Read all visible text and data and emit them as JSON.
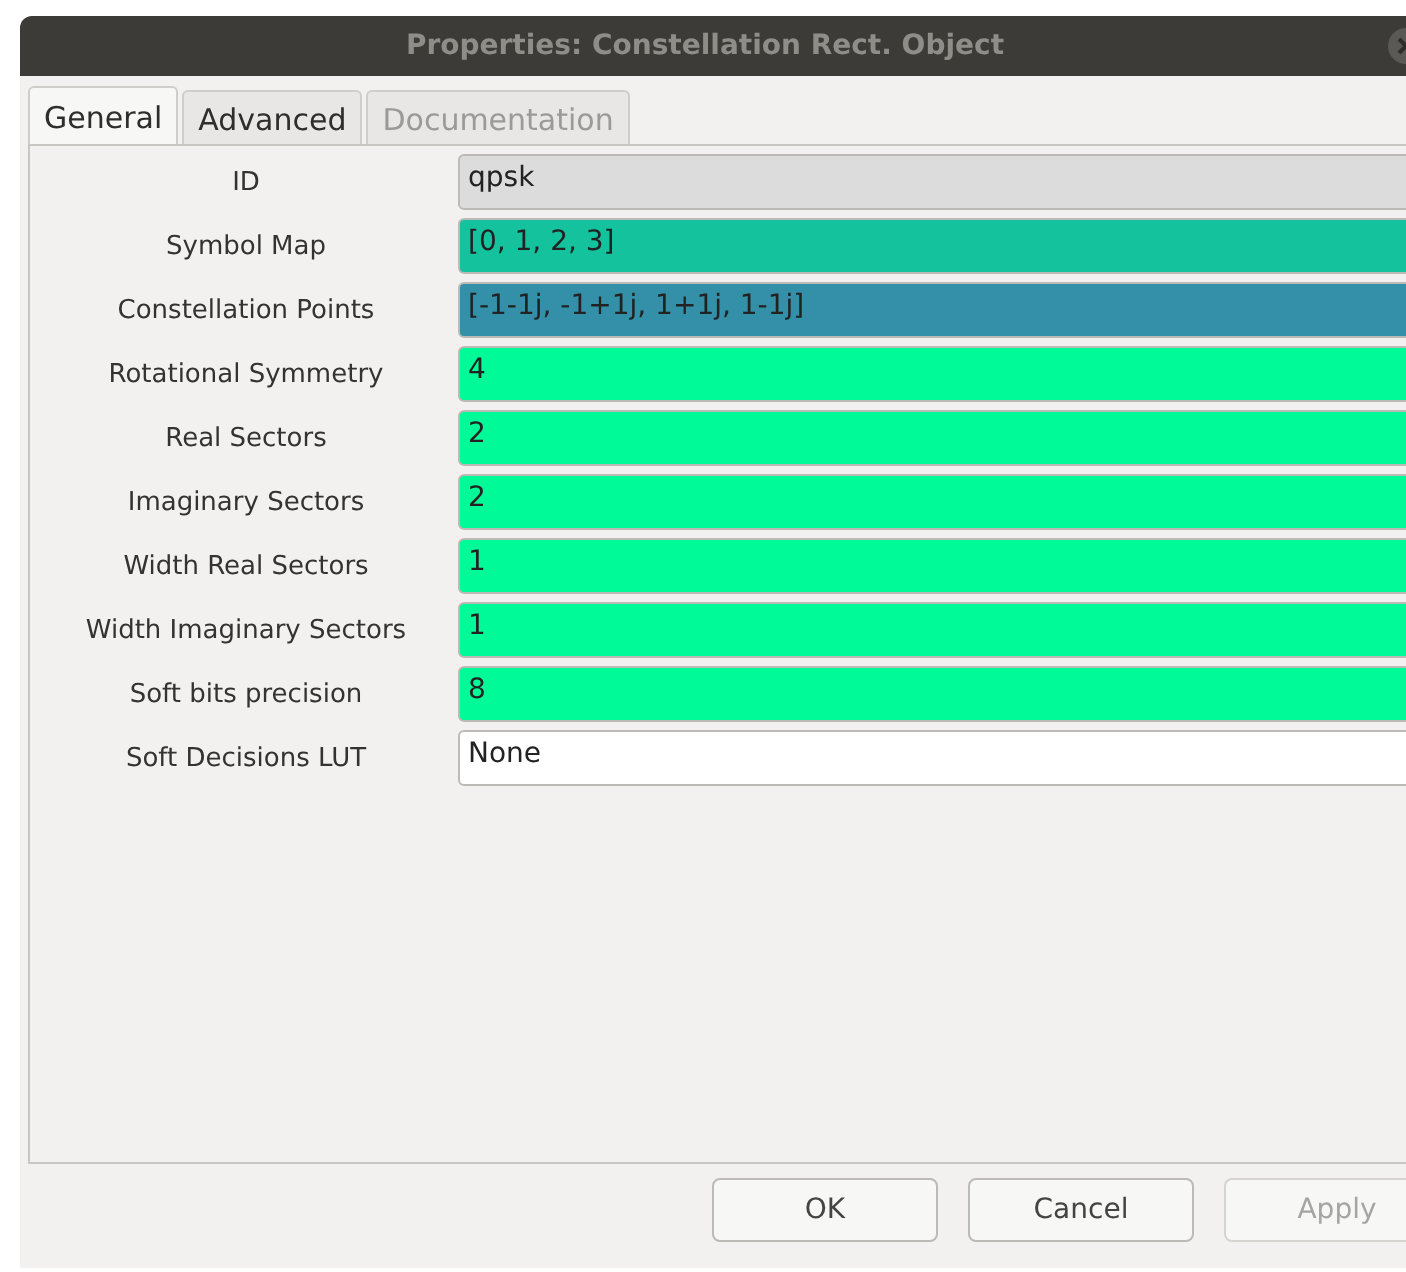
{
  "window": {
    "title": "Properties: Constellation Rect. Object"
  },
  "tabs": [
    {
      "label": "General",
      "selected": true,
      "disabled": false
    },
    {
      "label": "Advanced",
      "selected": false,
      "disabled": false
    },
    {
      "label": "Documentation",
      "selected": false,
      "disabled": true
    }
  ],
  "properties": [
    {
      "label": "ID",
      "value": "qpsk",
      "color": "#dcdcdc"
    },
    {
      "label": "Symbol Map",
      "value": "[0, 1, 2, 3]",
      "color": "#14c39e"
    },
    {
      "label": "Constellation Points",
      "value": "[-1-1j, -1+1j, 1+1j, 1-1j]",
      "color": "#3490a8"
    },
    {
      "label": "Rotational Symmetry",
      "value": "4",
      "color": "#00fa98"
    },
    {
      "label": "Real Sectors",
      "value": "2",
      "color": "#00fa98"
    },
    {
      "label": "Imaginary Sectors",
      "value": "2",
      "color": "#00fa98"
    },
    {
      "label": "Width Real Sectors",
      "value": "1",
      "color": "#00fa98"
    },
    {
      "label": "Width Imaginary Sectors",
      "value": "1",
      "color": "#00fa98"
    },
    {
      "label": "Soft bits precision",
      "value": "8",
      "color": "#00fa98"
    },
    {
      "label": "Soft Decisions LUT",
      "value": "None",
      "color": "#ffffff"
    }
  ],
  "buttons": [
    {
      "label": "OK",
      "disabled": false
    },
    {
      "label": "Cancel",
      "disabled": false
    },
    {
      "label": "Apply",
      "disabled": true
    }
  ]
}
